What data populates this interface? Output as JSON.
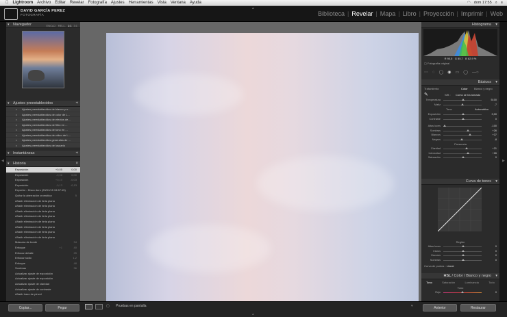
{
  "menubar": {
    "app": "Lightroom",
    "items": [
      "Archivo",
      "Editar",
      "Revelar",
      "Fotografía",
      "Ajustes",
      "Herramientas",
      "Vista",
      "Ventana",
      "Ayuda"
    ],
    "clock": "dom 17:55"
  },
  "identity": {
    "name": "DAVID GARCÍA PEREZ",
    "subtitle": "FOTOGRAFÍA"
  },
  "modules": [
    "Biblioteca",
    "Revelar",
    "Mapa",
    "Libro",
    "Proyección",
    "Imprimir",
    "Web"
  ],
  "modules_active": "Revelar",
  "left": {
    "navigator": {
      "title": "Navegador",
      "tabs": [
        "ENCAJ.",
        "RELL.",
        "1:1",
        "3:1"
      ]
    },
    "presets": {
      "title": "Ajustes preestablecidos",
      "items": [
        "Ajustes preestablecidos de blanco y n...",
        "Ajustes preestablecidos de color de L...",
        "Ajustes preestablecidos de efectos de...",
        "Ajustes preestablecidos de filtro en ...",
        "Ajustes preestablecidos de tono en ...",
        "Ajustes preestablecidos de vídeo de L...",
        "Ajustes preestablecidos generales de ...",
        "Ajustes preestablecidos del usuario"
      ]
    },
    "snapshots": {
      "title": "Instantáneas"
    },
    "history": {
      "title": "Historia",
      "rows": [
        {
          "label": "Exposición",
          "v1": "+0,05",
          "v2": "0,00",
          "sel": true
        },
        {
          "label": "Exposición",
          "v1": "-0,08",
          "v2": "0,00"
        },
        {
          "label": "Exposición",
          "v1": "+0,10",
          "v2": "-0,03"
        },
        {
          "label": "Exposición",
          "v1": "-0,13",
          "v2": "-0,13"
        },
        {
          "label": "Exportar - Disco duro (20/01/15 15:57:15)",
          "v1": "",
          "v2": ""
        },
        {
          "label": "Quitar la aberración cromática",
          "v1": "",
          "v2": "5"
        },
        {
          "label": "Añadir eliminación de tinta plana",
          "v1": "",
          "v2": ""
        },
        {
          "label": "Añadir eliminación de tinta plana",
          "v1": "",
          "v2": ""
        },
        {
          "label": "Añadir eliminación de tinta plana",
          "v1": "",
          "v2": ""
        },
        {
          "label": "Añadir eliminación de tinta plana",
          "v1": "",
          "v2": ""
        },
        {
          "label": "Añadir eliminación de tinta plana",
          "v1": "",
          "v2": ""
        },
        {
          "label": "Añadir eliminación de tinta plana",
          "v1": "",
          "v2": ""
        },
        {
          "label": "Añadir eliminación de tinta plana",
          "v1": "",
          "v2": ""
        },
        {
          "label": "Añadir eliminación de tinta plana",
          "v1": "",
          "v2": ""
        },
        {
          "label": "Máscara de borde",
          "v1": "",
          "v2": "34"
        },
        {
          "label": "Enfoque",
          "v1": "+1",
          "v2": "40"
        },
        {
          "label": "Enfocar detalle",
          "v1": "",
          "v2": "25"
        },
        {
          "label": "Enfocar radio",
          "v1": "",
          "v2": "1,2"
        },
        {
          "label": "Enfoque",
          "v1": "",
          "v2": "48"
        },
        {
          "label": "Sombras",
          "v1": "",
          "v2": "36"
        },
        {
          "label": "Actualizar ajuste de exposición",
          "v1": "",
          "v2": ""
        },
        {
          "label": "Actualizar ajuste de exposición",
          "v1": "",
          "v2": ""
        },
        {
          "label": "Actualizar ajuste de claridad",
          "v1": "",
          "v2": ""
        },
        {
          "label": "Actualizar ajuste de contraste",
          "v1": "",
          "v2": ""
        },
        {
          "label": "Añadir trazo de pincel",
          "v1": "",
          "v2": ""
        }
      ]
    },
    "copy_label": "Copiar...",
    "paste_label": "Pegar"
  },
  "toolbar": {
    "proof_label": "Pruebas en pantalla"
  },
  "right": {
    "histogram": {
      "title": "Histograma",
      "readout": [
        "R  90,5",
        "G  85,7",
        "B  82,9 %"
      ],
      "original_label": "Fotografía original"
    },
    "basic": {
      "title": "Básicos",
      "treatment_label": "Tratamiento:",
      "color_label": "Color",
      "bw_label": "Blanco y negro",
      "wb_label": "WB :",
      "wb_value": "Como se ha tomado",
      "rows1": [
        {
          "label": "Temperatura",
          "val": "5100",
          "pos": 0.5
        },
        {
          "label": "Matiz",
          "val": "-7",
          "pos": 0.48
        }
      ],
      "tone_label": "Tono",
      "auto_label": "Automático",
      "rows2": [
        {
          "label": "Exposición",
          "val": "0,00",
          "pos": 0.5
        },
        {
          "label": "Contraste",
          "val": "0",
          "pos": 0.5
        }
      ],
      "rows3": [
        {
          "label": "Altas luces",
          "val": "-100",
          "pos": 0.0
        },
        {
          "label": "Sombras",
          "val": "+26",
          "pos": 0.63
        },
        {
          "label": "Blancos",
          "val": "+37",
          "pos": 0.68
        },
        {
          "label": "Negros",
          "val": "-8",
          "pos": 0.46
        }
      ],
      "presence_label": "Presencia",
      "rows4": [
        {
          "label": "Claridad",
          "val": "+21",
          "pos": 0.6
        },
        {
          "label": "Intensidad",
          "val": "+26",
          "pos": 0.63
        },
        {
          "label": "Saturación",
          "val": "0",
          "pos": 0.5
        }
      ]
    },
    "curve": {
      "title": "Curva de tonos",
      "region_label": "Región",
      "rows": [
        {
          "label": "Altas luces",
          "val": "0"
        },
        {
          "label": "Claros",
          "val": "0"
        },
        {
          "label": "Oscuros",
          "val": "0"
        },
        {
          "label": "Sombras",
          "val": "0"
        }
      ],
      "channel_label": "Curva de puntos :",
      "channel_value": "Lineal"
    },
    "hsl": {
      "title_parts": [
        "HSL",
        "Color",
        "Blanco y negro"
      ],
      "tabs": [
        "Tono",
        "Saturación",
        "Luminancia",
        "Todo"
      ],
      "sub_label": "Tono",
      "row_label": "Rojo",
      "row_val": "0"
    },
    "prev_label": "Anterior",
    "reset_label": "Restaurar"
  }
}
